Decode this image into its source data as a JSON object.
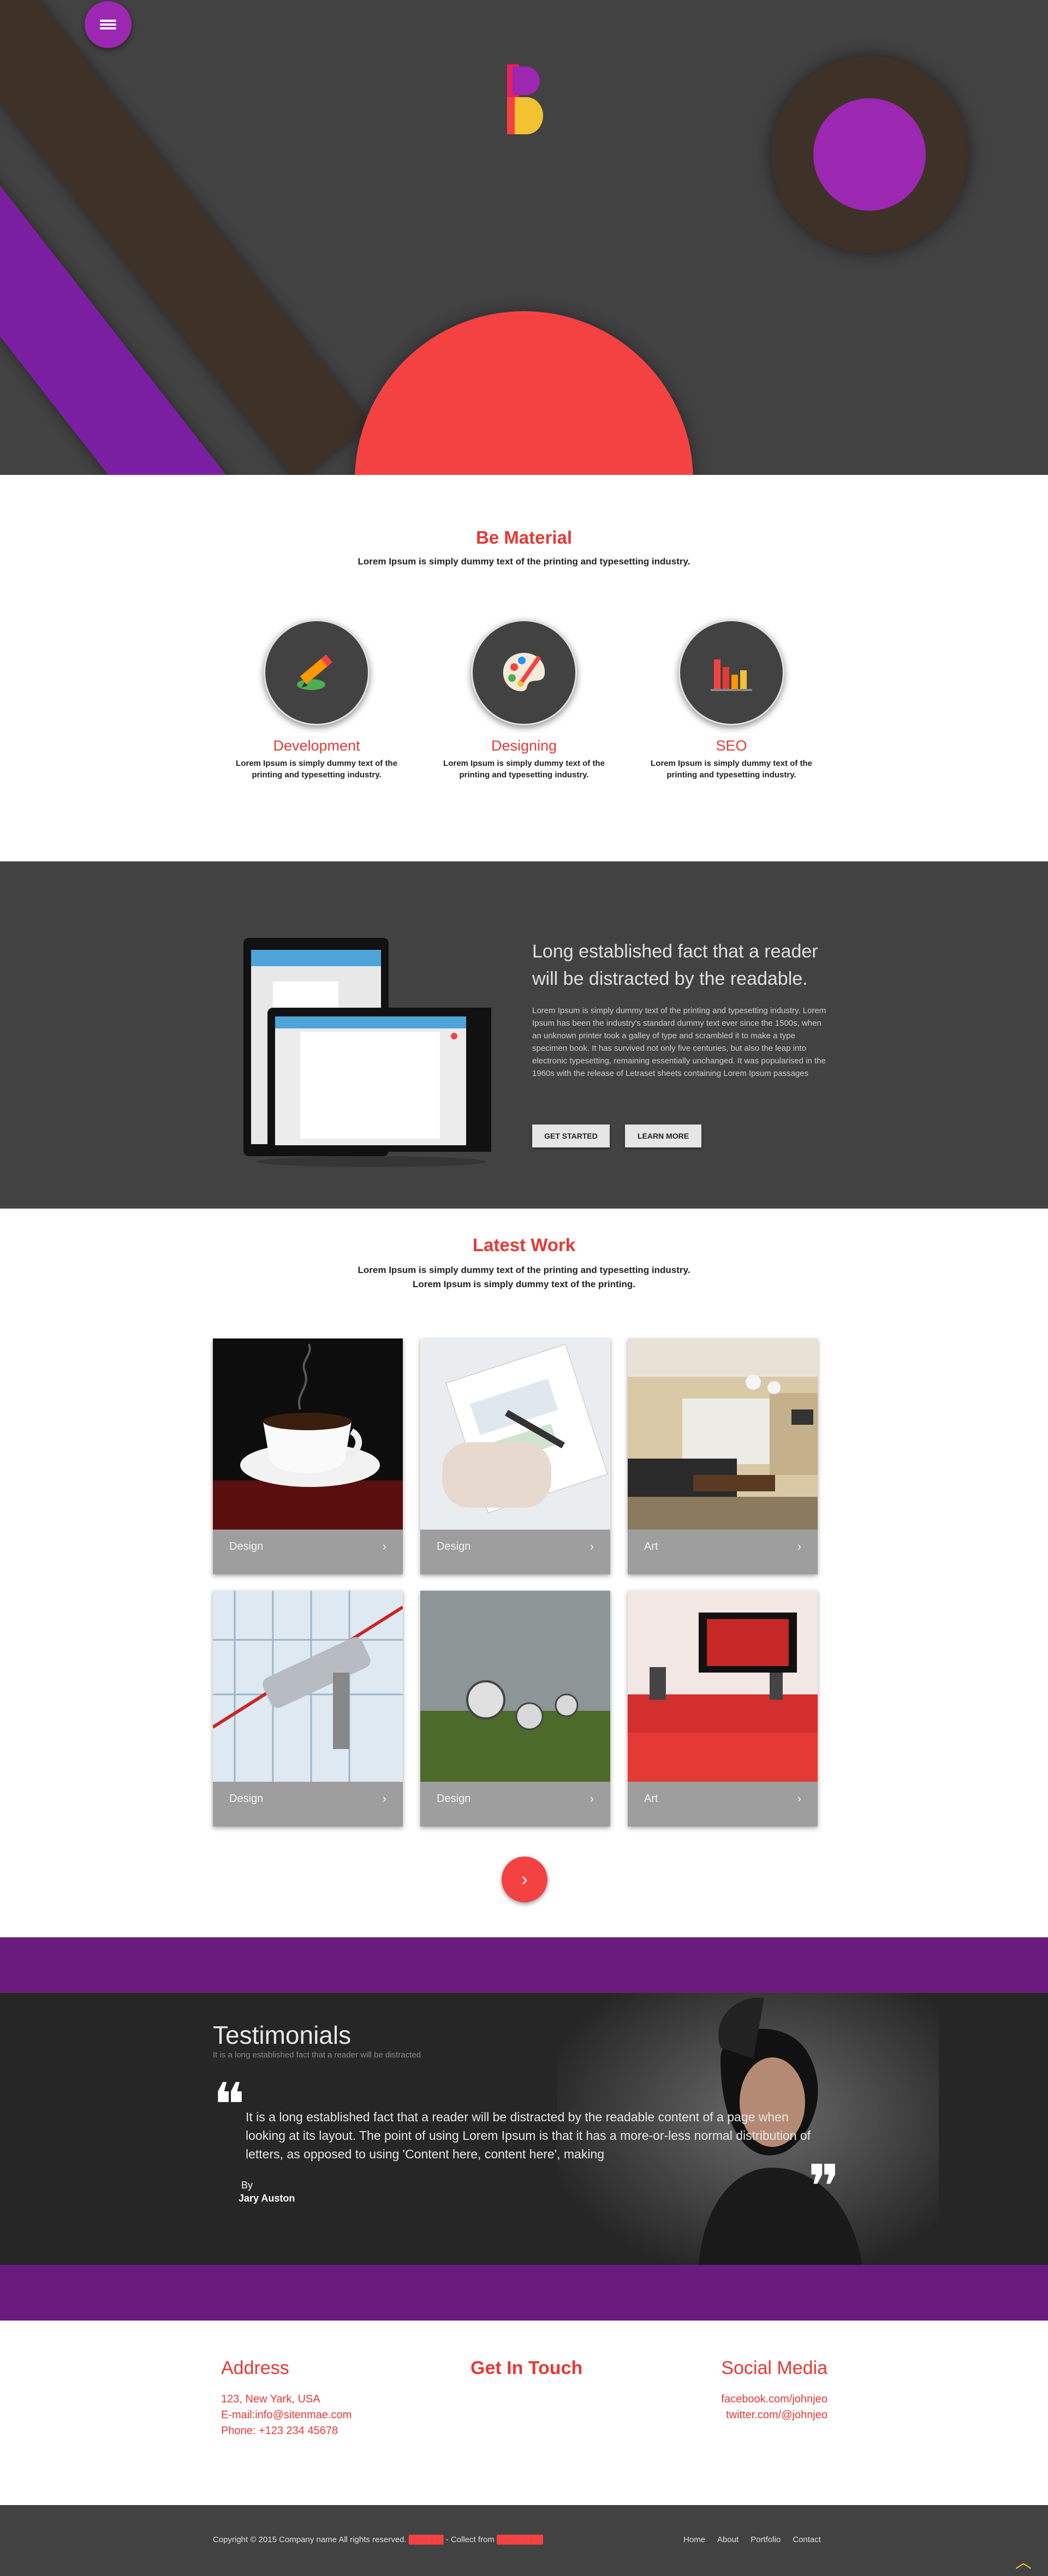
{
  "colors": {
    "accent_red": "#e53935",
    "hero_purple": "#9c27b0",
    "hero_yellow": "#f2c230",
    "dark_gray": "#424242",
    "band_purple": "#6a1b7e"
  },
  "hero": {
    "menu_icon": "hamburger-menu-icon",
    "logo_letter": "B"
  },
  "material": {
    "title": "Be Material",
    "subtitle": "Lorem Ipsum is simply dummy text of the printing and typesetting industry.",
    "services": [
      {
        "icon": "pencil-icon",
        "name": "Development",
        "desc": "Lorem Ipsum is simply dummy text of the printing and typesetting industry."
      },
      {
        "icon": "palette-icon",
        "name": "Designing",
        "desc": "Lorem Ipsum is simply dummy text of the printing and typesetting industry."
      },
      {
        "icon": "bar-chart-icon",
        "name": "SEO",
        "desc": "Lorem Ipsum is simply dummy text of the printing and typesetting industry."
      }
    ]
  },
  "feature": {
    "headline": "Long established fact that a reader will be distracted by the readable.",
    "body": "Lorem Ipsum is simply dummy text of the printing and typesetting industry. Lorem Ipsum has been the industry's standard dummy text ever since the 1500s, when an unknown printer took a galley of type and scrambled it to make a type specimen book. It has survived not only five centuries, but also the leap into electronic typesetting, remaining essentially unchanged. It was popularised in the 1960s with the release of Letraset sheets containing Lorem Ipsum passages",
    "primary_button": "GET STARTED",
    "secondary_button": "LEARN MORE"
  },
  "work": {
    "title": "Latest Work",
    "subtitle_line1": "Lorem Ipsum is simply dummy text of the printing and typesetting industry.",
    "subtitle_line2": "Lorem Ipsum is simply dummy text of the printing.",
    "items": [
      {
        "label": "Design",
        "image": "coffee-cup"
      },
      {
        "label": "Design",
        "image": "clipboard-chart"
      },
      {
        "label": "Art",
        "image": "living-room"
      },
      {
        "label": "Design",
        "image": "security-camera"
      },
      {
        "label": "Design",
        "image": "melting-clocks"
      },
      {
        "label": "Art",
        "image": "red-interior"
      }
    ],
    "arrow_glyph": "›",
    "next_glyph": "›"
  },
  "testimonials": {
    "title": "Testimonials",
    "subtitle": "It is a long established fact that a reader will be distracted",
    "quote": "It is a long established fact that a reader will be distracted by the readable content of a page when looking at its layout. The point of using Lorem Ipsum is that it has a more-or-less normal distribution of letters, as opposed to using 'Content here, content here', making",
    "by": "By",
    "author": "Jary Auston",
    "open_quote": "❝",
    "close_quote": "❞"
  },
  "contact": {
    "address_title": "Address",
    "address_lines": [
      "123, New Yark, USA",
      "E-mail:info@sitenmae.com",
      "Phone: +123 234 45678"
    ],
    "touch_title": "Get In Touch",
    "social_title": "Social Media",
    "social_lines": [
      "facebook.com/johnjeo",
      "twitter.com/@johnjeo"
    ]
  },
  "footer": {
    "copyright": "Copyright © 2015 Company name All rights reserved.",
    "collect_from": "- Collect from",
    "nav": [
      "Home",
      "About",
      "Portfolio",
      "Contact"
    ],
    "totop_glyph": "︿"
  }
}
